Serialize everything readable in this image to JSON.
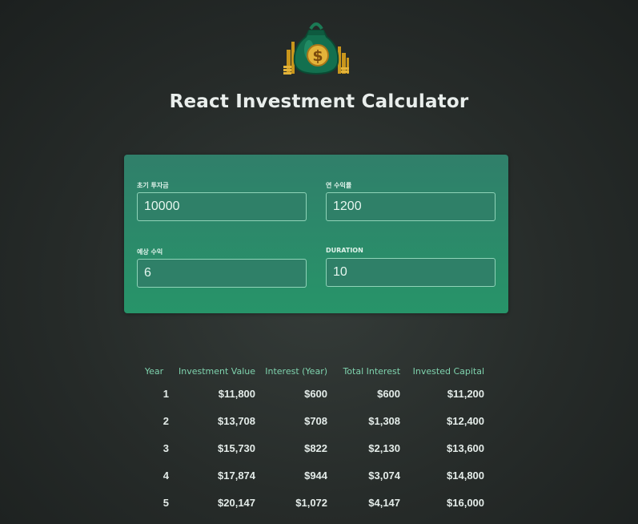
{
  "app": {
    "title": "React Investment Calculator"
  },
  "logo": {
    "icon": "money-bag-icon",
    "glyph": "$"
  },
  "inputs": [
    {
      "label": "초기 투자금",
      "value": "10000"
    },
    {
      "label": "연 수익률",
      "value": "1200"
    },
    {
      "label": "예상 수익",
      "value": "6"
    },
    {
      "label": "DURATION",
      "value": "10"
    }
  ],
  "table": {
    "headers": [
      "Year",
      "Investment Value",
      "Interest (Year)",
      "Total Interest",
      "Invested Capital"
    ],
    "rows": [
      [
        "1",
        "$11,800",
        "$600",
        "$600",
        "$11,200"
      ],
      [
        "2",
        "$13,708",
        "$708",
        "$1,308",
        "$12,400"
      ],
      [
        "3",
        "$15,730",
        "$822",
        "$2,130",
        "$13,600"
      ],
      [
        "4",
        "$17,874",
        "$944",
        "$3,074",
        "$14,800"
      ],
      [
        "5",
        "$20,147",
        "$1,072",
        "$4,147",
        "$16,000"
      ]
    ]
  },
  "colors": {
    "accent": "#279469",
    "header_text": "#7fd3ae",
    "background": "#2c3230"
  }
}
